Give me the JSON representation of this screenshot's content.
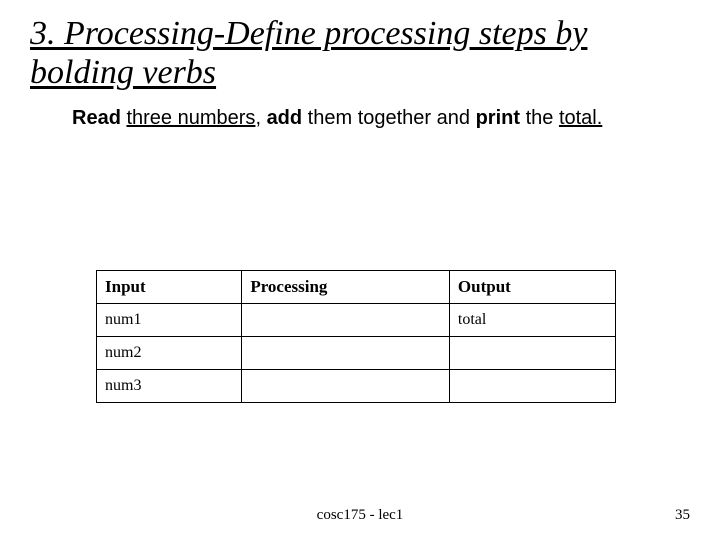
{
  "title": "3. Processing-Define processing steps by bolding verbs",
  "instruction": {
    "parts": [
      {
        "text": "Read",
        "bold": true,
        "underline": false
      },
      {
        "text": " ",
        "bold": false,
        "underline": false
      },
      {
        "text": "three numbers",
        "bold": false,
        "underline": true
      },
      {
        "text": ", ",
        "bold": false,
        "underline": false
      },
      {
        "text": "add",
        "bold": true,
        "underline": false
      },
      {
        "text": " them together and ",
        "bold": false,
        "underline": false
      },
      {
        "text": "print",
        "bold": true,
        "underline": false
      },
      {
        "text": " the ",
        "bold": false,
        "underline": false
      },
      {
        "text": "total.",
        "bold": false,
        "underline": true
      }
    ]
  },
  "table": {
    "headers": [
      "Input",
      "Processing",
      "Output"
    ],
    "rows": [
      {
        "input": "num1",
        "processing": "",
        "output": "total"
      },
      {
        "input": "num2",
        "processing": "",
        "output": ""
      },
      {
        "input": "num3",
        "processing": "",
        "output": ""
      }
    ]
  },
  "footer": {
    "course": "cosc175 - lec1",
    "page": "35"
  }
}
